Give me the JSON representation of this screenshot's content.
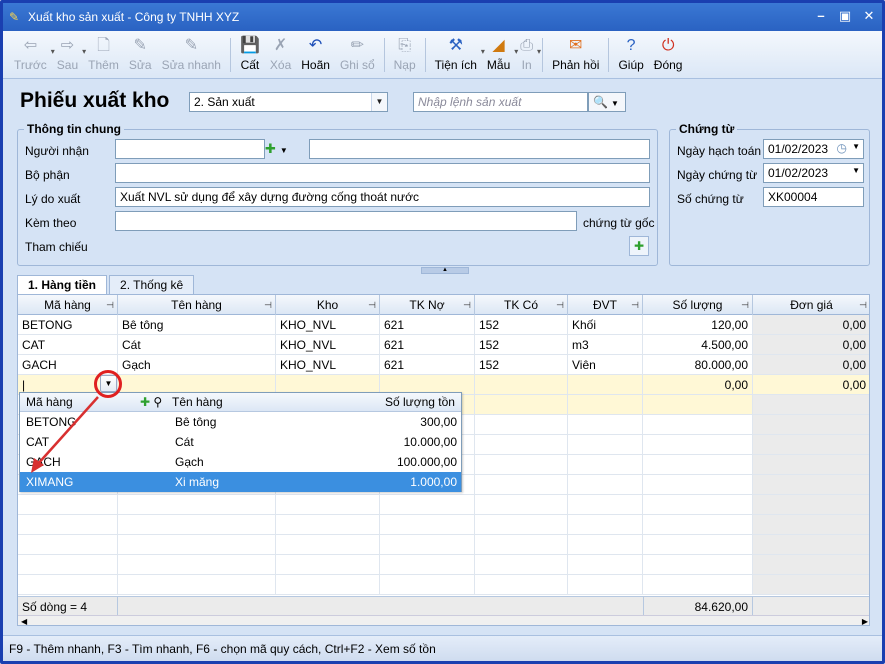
{
  "window": {
    "title": "Xuất kho sản xuất - Công ty TNHH XYZ"
  },
  "toolbar": [
    {
      "id": "prev",
      "label": "Trước",
      "icon": "arrow-left-icon",
      "disabled": true,
      "dropdown": true,
      "glyph": "⇦"
    },
    {
      "id": "next",
      "label": "Sau",
      "icon": "arrow-right-icon",
      "disabled": true,
      "dropdown": true,
      "glyph": "⇨"
    },
    {
      "id": "add",
      "label": "Thêm",
      "icon": "new-doc-icon",
      "disabled": true,
      "glyph": "🗋"
    },
    {
      "id": "edit",
      "label": "Sửa",
      "icon": "edit-doc-icon",
      "disabled": true,
      "glyph": "✎"
    },
    {
      "id": "quickedit",
      "label": "Sửa nhanh",
      "icon": "quick-edit-icon",
      "disabled": true,
      "glyph": "✎"
    },
    {
      "id": "save",
      "label": "Cất",
      "icon": "save-icon",
      "disabled": false,
      "glyph": "💾"
    },
    {
      "id": "delete",
      "label": "Xóa",
      "icon": "delete-icon",
      "disabled": true,
      "glyph": "✗"
    },
    {
      "id": "undo",
      "label": "Hoãn",
      "icon": "undo-icon",
      "disabled": false,
      "glyph": "↶"
    },
    {
      "id": "post",
      "label": "Ghi sổ",
      "icon": "pencil-icon",
      "disabled": true,
      "glyph": "✏"
    },
    {
      "id": "load",
      "label": "Nạp",
      "icon": "load-icon",
      "disabled": true,
      "glyph": "⎘"
    },
    {
      "id": "utility",
      "label": "Tiện ích",
      "icon": "tools-icon",
      "disabled": false,
      "dropdown": true,
      "glyph": "⚒"
    },
    {
      "id": "template",
      "label": "Mẫu",
      "icon": "template-icon",
      "disabled": false,
      "dropdown": true,
      "glyph": "◢"
    },
    {
      "id": "print",
      "label": "In",
      "icon": "printer-icon",
      "disabled": true,
      "dropdown": true,
      "glyph": "⎙"
    },
    {
      "id": "feedback",
      "label": "Phản hồi",
      "icon": "mail-icon",
      "disabled": false,
      "glyph": "✉"
    },
    {
      "id": "help",
      "label": "Giúp",
      "icon": "help-icon",
      "disabled": false,
      "glyph": "?"
    },
    {
      "id": "close",
      "label": "Đóng",
      "icon": "power-icon",
      "disabled": false,
      "glyph": "⏻"
    }
  ],
  "header": {
    "title": "Phiếu xuất kho",
    "type_value": "2. Sản xuất",
    "order_placeholder": "Nhập lệnh sản xuất"
  },
  "general": {
    "title": "Thông tin chung",
    "receiver_label": "Người nhận",
    "receiver_value": "",
    "receiver_name": "",
    "dept_label": "Bộ phận",
    "dept_value": "",
    "reason_label": "Lý do xuất",
    "reason_value": "Xuất NVL sử dụng để xây dựng đường cống thoát nước",
    "attach_label": "Kèm theo",
    "attach_value": "",
    "attach_suffix": "chứng từ gốc",
    "ref_label": "Tham chiếu"
  },
  "voucher": {
    "title": "Chứng từ",
    "posting_date_label": "Ngày hạch toán",
    "posting_date": "01/02/2023",
    "voucher_date_label": "Ngày chứng từ",
    "voucher_date": "01/02/2023",
    "voucher_no_label": "Số chứng từ",
    "voucher_no": "XK00004"
  },
  "tabs": [
    {
      "label": "1. Hàng tiền",
      "active": true
    },
    {
      "label": "2. Thống kê",
      "active": false
    }
  ],
  "grid": {
    "columns": [
      "Mã hàng",
      "Tên hàng",
      "Kho",
      "TK Nợ",
      "TK Có",
      "ĐVT",
      "Số lượng",
      "Đơn giá"
    ],
    "rows": [
      [
        "BETONG",
        "Bê tông",
        "KHO_NVL",
        "621",
        "152",
        "Khối",
        "120,00",
        "0,00"
      ],
      [
        "CAT",
        "Cát",
        "KHO_NVL",
        "621",
        "152",
        "m3",
        "4.500,00",
        "0,00"
      ],
      [
        "GACH",
        "Gạch",
        "KHO_NVL",
        "621",
        "152",
        "Viên",
        "80.000,00",
        "0,00"
      ]
    ],
    "edit_row": {
      "qty": "0,00",
      "price": "0,00"
    },
    "footer_count": "Số dòng = 4",
    "footer_total": "84.620,00"
  },
  "popup": {
    "columns": [
      "Mã hàng",
      "Tên hàng",
      "Số lượng tồn"
    ],
    "rows": [
      {
        "code": "BETONG",
        "name": "Bê tông",
        "qty": "300,00",
        "selected": false
      },
      {
        "code": "CAT",
        "name": "Cát",
        "qty": "10.000,00",
        "selected": false
      },
      {
        "code": "GACH",
        "name": "Gạch",
        "qty": "100.000,00",
        "selected": false
      },
      {
        "code": "XIMANG",
        "name": "Xi măng",
        "qty": "1.000,00",
        "selected": true
      }
    ]
  },
  "statusbar": "F9 - Thêm nhanh, F3 - Tìm nhanh, F6 - chọn mã quy cách, Ctrl+F2 - Xem số tồn",
  "colors": {
    "accent": "#3b8fe0",
    "highlight": "#e02020",
    "title_bar": "#2a62c2"
  }
}
